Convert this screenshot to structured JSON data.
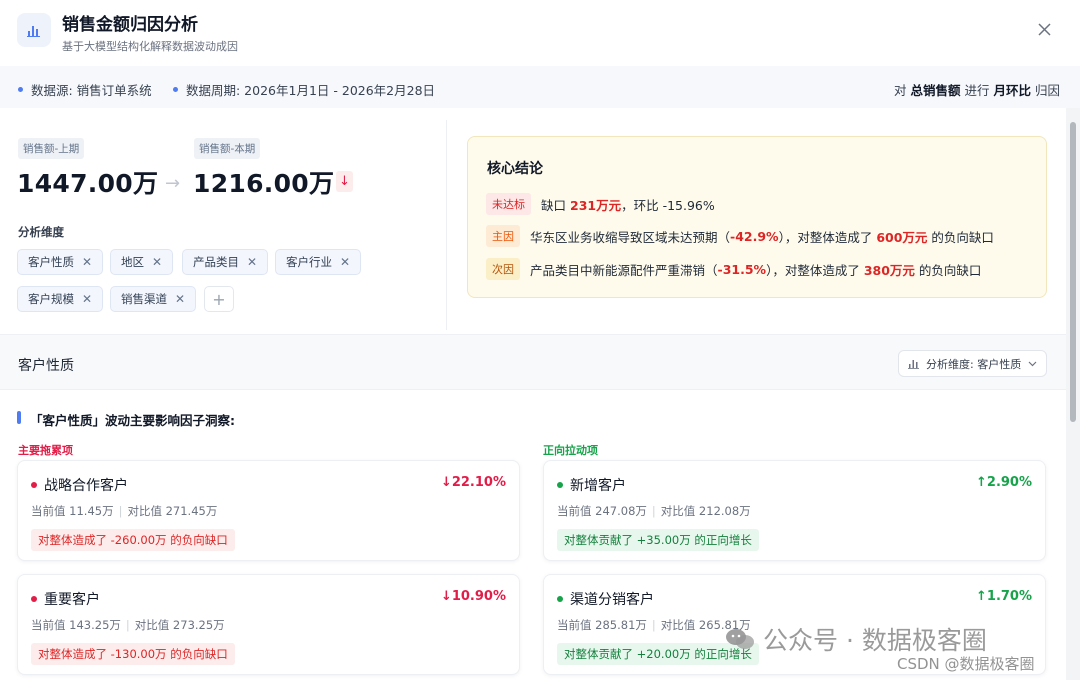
{
  "header": {
    "title": "销售金额归因分析",
    "subtitle": "基于大模型结构化解释数据波动成因",
    "app_icon": "bar-chart-icon",
    "close_icon": "close-icon"
  },
  "infobar": {
    "source": "数据源: 销售订单系统",
    "period": "数据周期: 2026年1月1日 - 2026年2月28日",
    "right_pre": "对",
    "right_metric": "总销售额",
    "right_mid": "进行",
    "right_method": "月环比",
    "right_post": "归因"
  },
  "summary": {
    "prev_label": "销售额-上期",
    "prev_value": "1447.00万",
    "curr_label": "销售额-本期",
    "curr_value": "1216.00万",
    "arrow": "→",
    "down_icon": "↓",
    "dims_label": "分析维度",
    "dims": [
      "客户性质",
      "地区",
      "产品类目",
      "客户行业",
      "客户规模",
      "销售渠道"
    ],
    "remove_glyph": "✕",
    "add_glyph": "+"
  },
  "conclusion": {
    "title": "核心结论",
    "row1": {
      "tag": "未达标",
      "pre": "缺口",
      "amount": "231万元",
      "post": "，环比 -15.96%"
    },
    "row2": {
      "tag": "主因",
      "pre": "华东区业务收缩导致区域未达预期（",
      "pct": "-42.9%",
      "mid": "），对整体造成了",
      "amount": "600万元",
      "post": "的负向缺口"
    },
    "row3": {
      "tag": "次因",
      "pre": "产品类目中新能源配件严重滞销（",
      "pct": "-31.5%",
      "mid": "），对整体造成了",
      "amount": "380万元",
      "post": "的负向缺口"
    }
  },
  "section": {
    "title": "客户性质",
    "select_label": "分析维度: 客户性质",
    "select_icon": "bar-chart-icon",
    "chevron": "chevron-down-icon"
  },
  "insight": {
    "title": "「客户性质」波动主要影响因子洞察:",
    "neg_label": "主要拖累项",
    "pos_label": "正向拉动项",
    "neg_cards": [
      {
        "name": "战略合作客户",
        "pct": "↓22.10%",
        "current": "当前值 11.45万",
        "compare": "对比值 271.45万",
        "note": "对整体造成了 -260.00万 的负向缺口"
      },
      {
        "name": "重要客户",
        "pct": "↓10.90%",
        "current": "当前值 143.25万",
        "compare": "对比值 273.25万",
        "note": "对整体造成了 -130.00万 的负向缺口"
      }
    ],
    "pos_cards": [
      {
        "name": "新增客户",
        "pct": "↑2.90%",
        "current": "当前值 247.08万",
        "compare": "对比值 212.08万",
        "note": "对整体贡献了 +35.00万 的正向增长"
      },
      {
        "name": "渠道分销客户",
        "pct": "↑1.70%",
        "current": "当前值 285.81万",
        "compare": "对比值 265.81万",
        "note": "对整体贡献了 +20.00万 的正向增长"
      }
    ]
  },
  "watermark": {
    "main": "公众号 · 数据极客圈",
    "sub": "CSDN @数据极客圈"
  },
  "colors": {
    "accent": "#4f7cf0",
    "negative": "#e11d48",
    "positive": "#16a34a",
    "conclusion_bg": "#fffbec"
  }
}
